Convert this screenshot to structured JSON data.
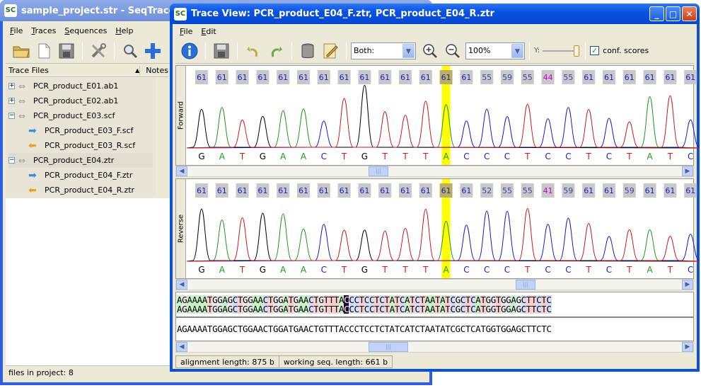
{
  "main_window": {
    "title": "sample_project.str - SeqTrace",
    "menu": [
      "File",
      "Traces",
      "Sequences",
      "Help"
    ],
    "tree_header": "Trace Files",
    "notes_header": "Notes",
    "tree_items": [
      {
        "label": "PCR_product_E01.ab1",
        "type": "pair",
        "expander": "+"
      },
      {
        "label": "PCR_product_E02.ab1",
        "type": "pair",
        "expander": "+"
      },
      {
        "label": "PCR_product_E03.scf",
        "type": "pair",
        "expander": "−"
      },
      {
        "label": "PCR_product_E03_F.scf",
        "type": "forward"
      },
      {
        "label": "PCR_product_E03_R.scf",
        "type": "reverse"
      },
      {
        "label": "PCR_product_E04.ztr",
        "type": "pair",
        "expander": "−"
      },
      {
        "label": "PCR_product_E04_F.ztr",
        "type": "forward"
      },
      {
        "label": "PCR_product_E04_R.ztr",
        "type": "reverse"
      }
    ],
    "status": "files in project: 8"
  },
  "trace_window": {
    "title": "Trace View: PCR_product_E04_F.ztr, PCR_product_E04_R.ztr",
    "menu": [
      "File",
      "Edit"
    ],
    "strand_select": "Both:",
    "zoom_select": "100%",
    "y_label": "Y:",
    "conf_label": "conf. scores",
    "conf_checked": true,
    "forward_label": "Forward",
    "reverse_label": "Reverse",
    "highlight_index": 12,
    "forward_bases": [
      "G",
      "A",
      "T",
      "G",
      "A",
      "A",
      "C",
      "T",
      "G",
      "T",
      "T",
      "T",
      "A",
      "C",
      "C",
      "C",
      "T",
      "C",
      "C",
      "T",
      "C",
      "T",
      "A",
      "T",
      "C"
    ],
    "forward_scores": [
      "61",
      "61",
      "61",
      "61",
      "61",
      "61",
      "61",
      "61",
      "61",
      "61",
      "61",
      "61",
      "61",
      "61",
      "55",
      "59",
      "55",
      "44",
      "55",
      "61",
      "61",
      "61",
      "61",
      "61",
      "61"
    ],
    "reverse_bases": [
      "G",
      "A",
      "T",
      "G",
      "A",
      "A",
      "C",
      "T",
      "G",
      "T",
      "T",
      "T",
      "A",
      "C",
      "C",
      "C",
      "T",
      "C",
      "C",
      "T",
      "C",
      "T",
      "A",
      "T",
      "C"
    ],
    "reverse_scores": [
      "61",
      "61",
      "61",
      "61",
      "61",
      "61",
      "61",
      "61",
      "61",
      "61",
      "61",
      "61",
      "61",
      "61",
      "52",
      "55",
      "55",
      "41",
      "59",
      "61",
      "61",
      "59",
      "61",
      "61",
      "61"
    ],
    "alignment_seq_1": "AGAAAATGGAGCTGGAACTGGATGAACTGTTTACCCTCCTCTATCATCTAATATCGCTCATGGTGGAGCTTCTC",
    "alignment_seq_2": "AGAAAATGGAGCTGGAACTGGATGAACTGTTTACCCTCCTCTATCATCTAATATCGCTCATGGTGGAGCTTCTC",
    "working_seq": "AGAAAATGGAGCTGGAACTGGATGAACTGTTTACCCTCCTCTATCATCTAATATCGCTCATGGTGGAGCTTCTC",
    "alignment_length": "alignment length: 875 b",
    "working_length": "working seq. length: 661 b"
  },
  "colors": {
    "A": "#1a9a1a",
    "C": "#1a1acc",
    "G": "#000000",
    "T": "#cc1a1a",
    "highlight": "#ffff00",
    "score_low": "#cc00cc"
  }
}
